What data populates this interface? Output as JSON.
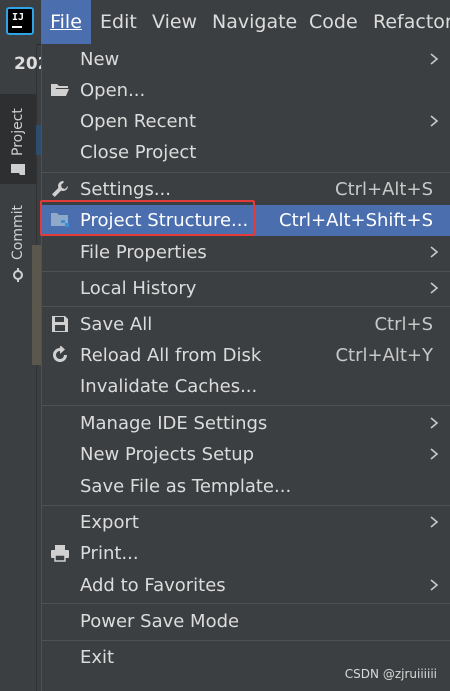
{
  "menubar": {
    "items": [
      {
        "label": "File",
        "mnemonic_index": 0
      },
      {
        "label": "Edit",
        "mnemonic_index": 0
      },
      {
        "label": "View",
        "mnemonic_index": 0
      },
      {
        "label": "Navigate",
        "mnemonic_index": 0
      },
      {
        "label": "Code",
        "mnemonic_index": 0
      },
      {
        "label": "Refactor",
        "mnemonic_index": 0
      }
    ],
    "app_icon_text": "IJ"
  },
  "background": {
    "year_fragment": "202"
  },
  "side_tabs": {
    "project": "Project",
    "commit": "Commit"
  },
  "file_menu": {
    "items": [
      {
        "label": "New",
        "shortcut": "",
        "submenu": true,
        "icon": ""
      },
      {
        "label": "Open...",
        "shortcut": "",
        "submenu": false,
        "icon": "folder-open-icon"
      },
      {
        "label": "Open Recent",
        "shortcut": "",
        "submenu": true,
        "icon": ""
      },
      {
        "label": "Close Project",
        "shortcut": "",
        "submenu": false,
        "icon": ""
      },
      {
        "label": "Settings...",
        "shortcut": "Ctrl+Alt+S",
        "submenu": false,
        "icon": "wrench-icon"
      },
      {
        "label": "Project Structure...",
        "shortcut": "Ctrl+Alt+Shift+S",
        "submenu": false,
        "icon": "project-structure-icon",
        "highlighted": true
      },
      {
        "label": "File Properties",
        "shortcut": "",
        "submenu": true,
        "icon": ""
      },
      {
        "label": "Local History",
        "shortcut": "",
        "submenu": true,
        "icon": ""
      },
      {
        "label": "Save All",
        "shortcut": "Ctrl+S",
        "submenu": false,
        "icon": "save-icon"
      },
      {
        "label": "Reload All from Disk",
        "shortcut": "Ctrl+Alt+Y",
        "submenu": false,
        "icon": "reload-icon"
      },
      {
        "label": "Invalidate Caches...",
        "shortcut": "",
        "submenu": false,
        "icon": ""
      },
      {
        "label": "Manage IDE Settings",
        "shortcut": "",
        "submenu": true,
        "icon": ""
      },
      {
        "label": "New Projects Setup",
        "shortcut": "",
        "submenu": true,
        "icon": ""
      },
      {
        "label": "Save File as Template...",
        "shortcut": "",
        "submenu": false,
        "icon": ""
      },
      {
        "label": "Export",
        "shortcut": "",
        "submenu": true,
        "icon": ""
      },
      {
        "label": "Print...",
        "shortcut": "",
        "submenu": false,
        "icon": "print-icon"
      },
      {
        "label": "Add to Favorites",
        "shortcut": "",
        "submenu": true,
        "icon": ""
      },
      {
        "label": "Power Save Mode",
        "shortcut": "",
        "submenu": false,
        "icon": ""
      },
      {
        "label": "Exit",
        "shortcut": "",
        "submenu": false,
        "icon": ""
      }
    ]
  },
  "watermark": "CSDN @zjruiiiiii",
  "colors": {
    "background": "#3c3f41",
    "highlight": "#4b6eaf",
    "annotation_box": "#e33a3a",
    "text": "#dcdcdc"
  }
}
